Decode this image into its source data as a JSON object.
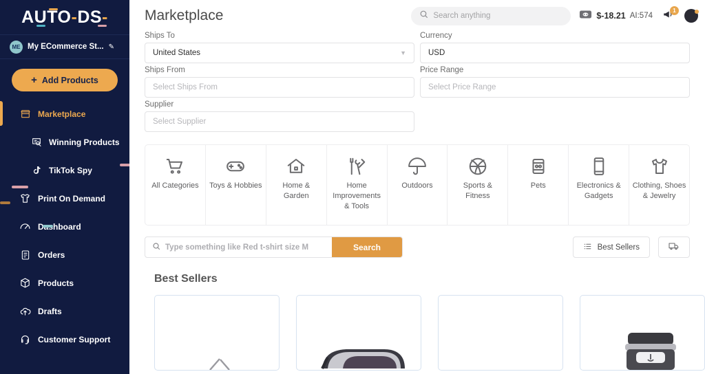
{
  "sidebar": {
    "logo": "AUTO-DS-",
    "store": {
      "initials": "ME",
      "name": "My ECommerce St...",
      "edit_icon": "pencil-icon"
    },
    "add_products_label": "Add Products",
    "items": [
      {
        "label": "Marketplace",
        "icon": "store-icon",
        "active": true,
        "sub": false
      },
      {
        "label": "Winning Products",
        "icon": "trophy-icon",
        "active": false,
        "sub": true
      },
      {
        "label": "TikTok Spy",
        "icon": "tiktok-icon",
        "active": false,
        "sub": true
      },
      {
        "label": "Print On Demand",
        "icon": "tshirt-icon",
        "active": false,
        "sub": false
      },
      {
        "label": "Dashboard",
        "icon": "gauge-icon",
        "active": false,
        "sub": false
      },
      {
        "label": "Orders",
        "icon": "clipboard-icon",
        "active": false,
        "sub": false
      },
      {
        "label": "Products",
        "icon": "box-icon",
        "active": false,
        "sub": false
      },
      {
        "label": "Drafts",
        "icon": "cloud-up-icon",
        "active": false,
        "sub": false
      },
      {
        "label": "Customer Support",
        "icon": "headset-icon",
        "active": false,
        "sub": false
      }
    ]
  },
  "header": {
    "title": "Marketplace",
    "search_placeholder": "Search anything",
    "search_value": "",
    "balance": "$-18.21",
    "ai_credits": "AI:574",
    "notification_count": "1",
    "wallet_icon": "wallet-icon",
    "bell_icon": "megaphone-icon",
    "avatar": "user-avatar"
  },
  "filters": [
    {
      "label": "Ships To",
      "value": "United States",
      "is_placeholder": false,
      "chevron": true
    },
    {
      "label": "Currency",
      "value": "USD",
      "is_placeholder": false,
      "chevron": false
    },
    {
      "label": "Ships From",
      "value": "Select Ships From",
      "is_placeholder": true,
      "chevron": false
    },
    {
      "label": "Price Range",
      "value": "Select Price Range",
      "is_placeholder": true,
      "chevron": false
    },
    {
      "label": "Supplier",
      "value": "Select Supplier",
      "is_placeholder": true,
      "chevron": false
    }
  ],
  "categories": [
    {
      "label": "All Categories",
      "icon": "cart-icon"
    },
    {
      "label": "Toys & Hobbies",
      "icon": "gamepad-icon"
    },
    {
      "label": "Home & Garden",
      "icon": "house-icon"
    },
    {
      "label": "Home Improvements & Tools",
      "icon": "tools-icon"
    },
    {
      "label": "Outdoors",
      "icon": "umbrella-icon"
    },
    {
      "label": "Sports & Fitness",
      "icon": "basketball-icon"
    },
    {
      "label": "Pets",
      "icon": "petfood-icon"
    },
    {
      "label": "Electronics & Gadgets",
      "icon": "phone-icon"
    },
    {
      "label": "Clothing, Shoes & Jewelry",
      "icon": "tshirt-icon"
    }
  ],
  "search_row": {
    "placeholder": "Type something like Red t-shirt size M",
    "value": "",
    "search_button": "Search",
    "best_sellers_label": "Best Sellers",
    "best_sellers_icon": "list-icon",
    "shipping_icon": "truck-icon"
  },
  "best_sellers": {
    "title": "Best Sellers",
    "cards": [
      {
        "product": "scissors-product"
      },
      {
        "product": "sunglasses-product"
      },
      {
        "product": "blank-product"
      },
      {
        "product": "blender-product"
      }
    ]
  },
  "colors": {
    "sidebar_bg": "#111b40",
    "accent_orange": "#eda94f",
    "search_orange": "#e09a43",
    "card_border": "#d6e2f0",
    "teal": "#8fc6cb"
  }
}
